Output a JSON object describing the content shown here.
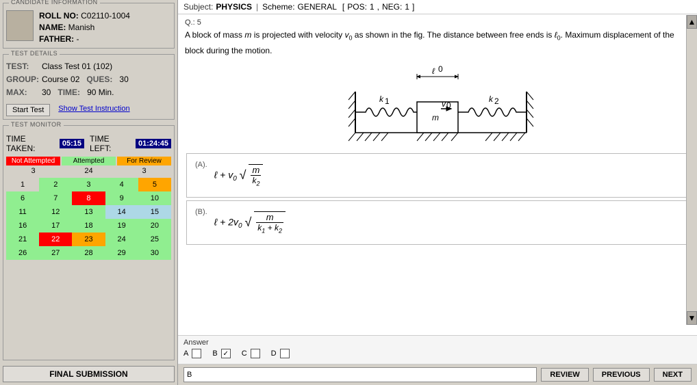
{
  "candidate": {
    "section_label": "CANDIDATE INFORMATION",
    "roll_label": "ROLL NO:",
    "roll_value": "C02110-1004",
    "name_label": "NAME:",
    "name_value": "Manish",
    "father_label": "FATHER:",
    "father_value": "-"
  },
  "test_details": {
    "section_label": "TEST DETAILS",
    "test_label": "TEST:",
    "test_value": "Class Test 01 (102)",
    "group_label": "GROUP:",
    "group_value": "Course 02",
    "ques_label": "QUES:",
    "ques_value": "30",
    "max_label": "MAX:",
    "max_value": "30",
    "time_label": "TIME:",
    "time_value": "90 Min.",
    "start_btn": "Start Test",
    "instruction_btn": "Show Test Instruction"
  },
  "test_monitor": {
    "section_label": "TEST MONITOR",
    "time_taken_label": "TIME TAKEN:",
    "time_taken_value": "05:15",
    "time_left_label": "TIME LEFT:",
    "time_left_value": "01:24:45",
    "not_attempted_label": "Not Attempted",
    "attempted_label": "Attempted",
    "for_review_label": "For Review",
    "not_attempted_count": "3",
    "attempted_count": "24",
    "for_review_count": "3"
  },
  "subject_bar": {
    "subject_label": "Subject:",
    "subject_name": "PHYSICS",
    "scheme_label": "Scheme:",
    "scheme_value": "GENERAL",
    "pos_label": "POS:",
    "pos_value": "1",
    "neg_label": "NEG:",
    "neg_value": "1"
  },
  "question": {
    "number": "Q.: 5",
    "text": "A block of mass m is projected with velocity v₀ as shown in the fig. The distance between free ends is ℓ₀. Maximum displacement of the block during the motion."
  },
  "options": {
    "a_label": "(A).",
    "a_formula": "ℓ + v₀√(m/k₂)",
    "b_label": "(B).",
    "b_formula": "ℓ + 2v₀√(m/(k₁+k₂))"
  },
  "answer": {
    "title": "Answer",
    "options": [
      "A",
      "B",
      "C",
      "D"
    ],
    "checked": [
      false,
      true,
      false,
      false
    ],
    "input_value": "B"
  },
  "buttons": {
    "review": "REVIEW",
    "previous": "PREVIOUS",
    "next": "NEXT",
    "final_submission": "FINAL SUBMISSION"
  }
}
